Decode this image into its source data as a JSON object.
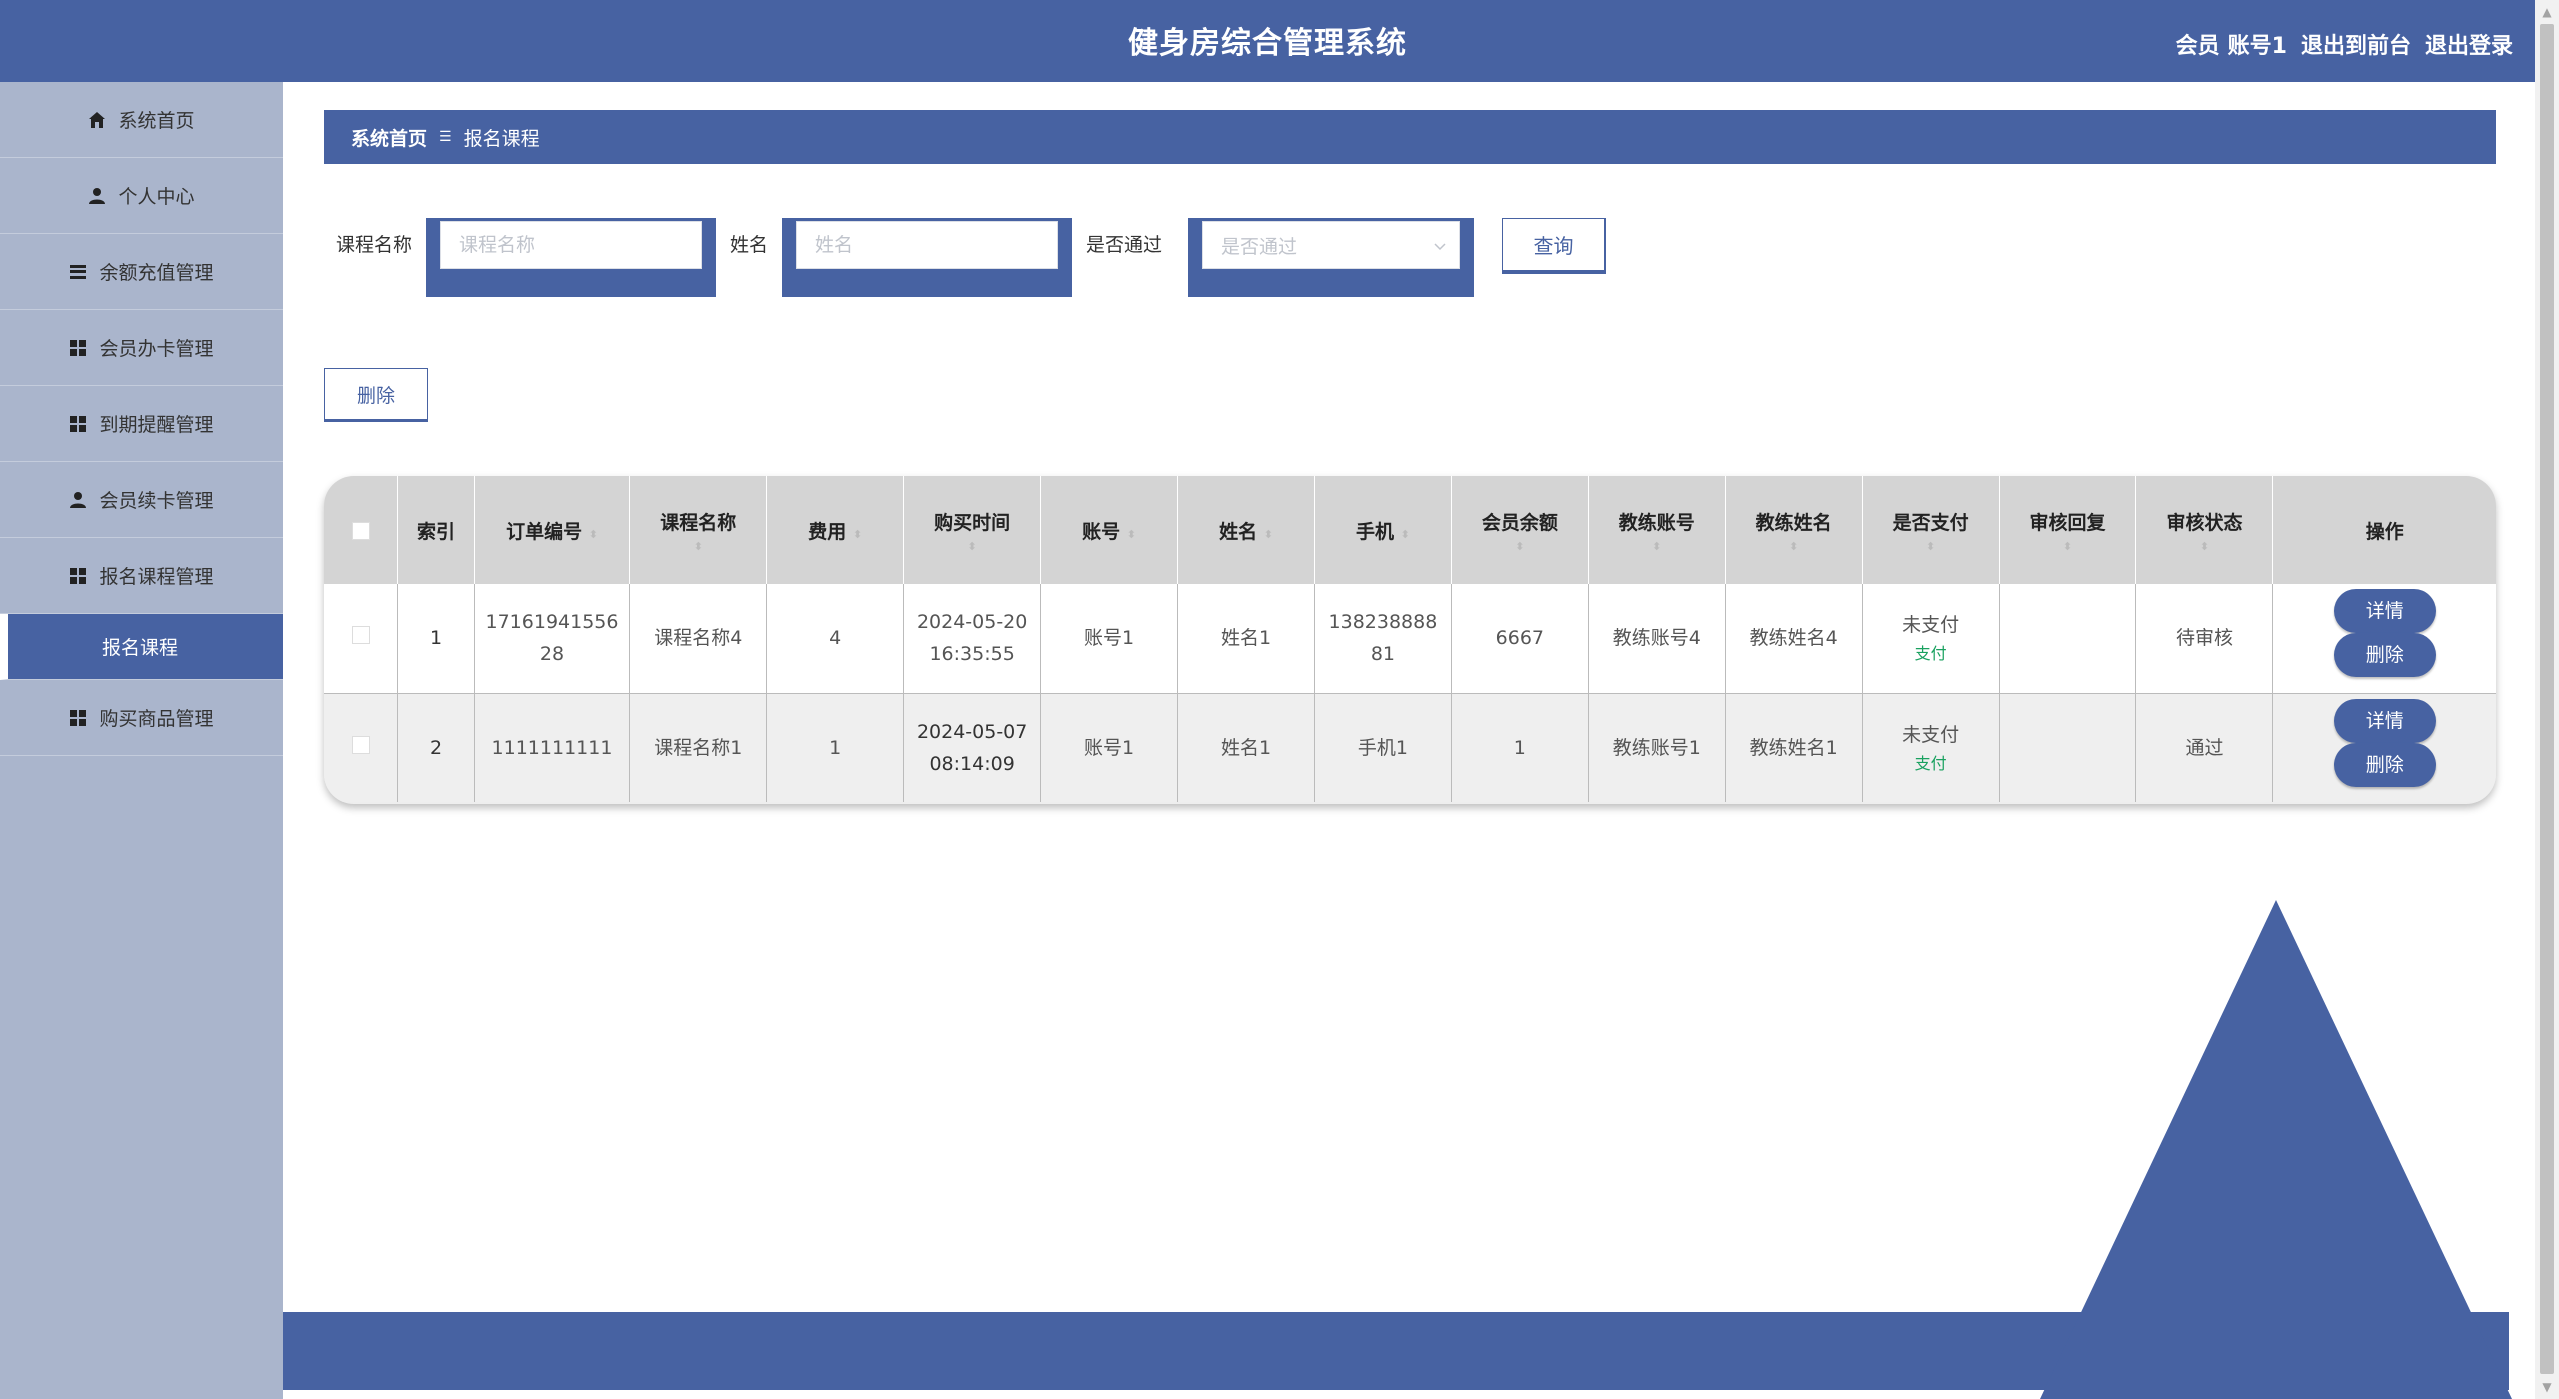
{
  "header": {
    "title": "健身房综合管理系统",
    "user_role": "会员",
    "username": "账号1",
    "to_front": "退出到前台",
    "logout": "退出登录"
  },
  "sidebar": {
    "items": [
      {
        "label": "系统首页",
        "icon": "home-icon"
      },
      {
        "label": "个人中心",
        "icon": "user-icon"
      },
      {
        "label": "余额充值管理",
        "icon": "list-icon"
      },
      {
        "label": "会员办卡管理",
        "icon": "grid-icon"
      },
      {
        "label": "到期提醒管理",
        "icon": "grid-icon"
      },
      {
        "label": "会员续卡管理",
        "icon": "user-icon"
      },
      {
        "label": "报名课程管理",
        "icon": "grid-icon"
      },
      {
        "label": "报名课程",
        "active": true
      },
      {
        "label": "购买商品管理",
        "icon": "grid-icon"
      }
    ]
  },
  "breadcrumb": {
    "home": "系统首页",
    "separator": "☰",
    "current": "报名课程"
  },
  "search": {
    "course_label": "课程名称",
    "course_placeholder": "课程名称",
    "name_label": "姓名",
    "name_placeholder": "姓名",
    "passed_label": "是否通过",
    "passed_placeholder": "是否通过",
    "query_button": "查询"
  },
  "actions": {
    "delete_button": "删除"
  },
  "table": {
    "headers": [
      "索引",
      "订单编号",
      "课程名称",
      "费用",
      "购买时间",
      "账号",
      "姓名",
      "手机",
      "会员余额",
      "教练账号",
      "教练姓名",
      "是否支付",
      "审核回复",
      "审核状态",
      "操作"
    ],
    "rows": [
      {
        "index": "1",
        "order_no": "1716194155628",
        "course": "课程名称4",
        "fee": "4",
        "time": "2024-05-20 16:35:55",
        "account": "账号1",
        "name": "姓名1",
        "phone": "13823888881",
        "balance": "6667",
        "coach_account": "教练账号4",
        "coach_name": "教练姓名4",
        "paid": "未支付",
        "pay_link": "支付",
        "reply": "",
        "status": "待审核",
        "detail_btn": "详情",
        "delete_btn": "删除"
      },
      {
        "index": "2",
        "order_no": "1111111111",
        "course": "课程名称1",
        "fee": "1",
        "time": "2024-05-07 08:14:09",
        "account": "账号1",
        "name": "姓名1",
        "phone": "手机1",
        "balance": "1",
        "coach_account": "教练账号1",
        "coach_name": "教练姓名1",
        "paid": "未支付",
        "pay_link": "支付",
        "reply": "",
        "status": "通过",
        "detail_btn": "详情",
        "delete_btn": "删除"
      }
    ]
  },
  "colors": {
    "primary": "#4762a2",
    "sidebar_bg": "#aab5cc",
    "pay_link": "#19a15f",
    "header_row": "#d4d4d4"
  }
}
